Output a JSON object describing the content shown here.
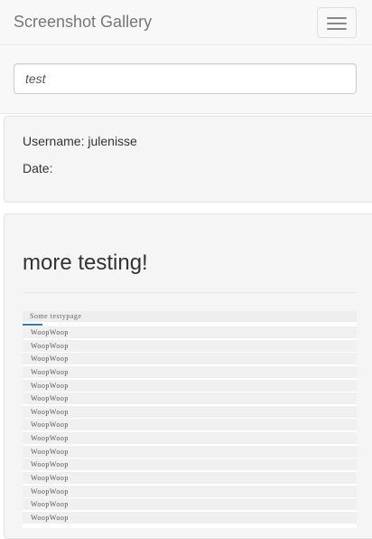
{
  "navbar": {
    "brand": "Screenshot Gallery",
    "toggle_icon": "hamburger-menu-icon"
  },
  "search": {
    "value": "test"
  },
  "info": {
    "username": "Username: julenisse",
    "date": "Date:"
  },
  "post": {
    "title": "more testing!",
    "screenshot": {
      "header": "Some   testypage",
      "rows": [
        "WoopWoop",
        "WoopWoop",
        "WoopWoop",
        "WoopWoop",
        "WoopWoop",
        "WoopWoop",
        "WoopWoop",
        "WoopWoop",
        "WoopWoop",
        "WoopWoop",
        "WoopWoop",
        "WoopWoop",
        "WoopWoop",
        "WoopWoop",
        "WoopWoop"
      ]
    }
  },
  "colors": {
    "navbar_bg": "#f8f8f8",
    "well_bg": "#f5f5f5",
    "accent": "#337ab7"
  }
}
